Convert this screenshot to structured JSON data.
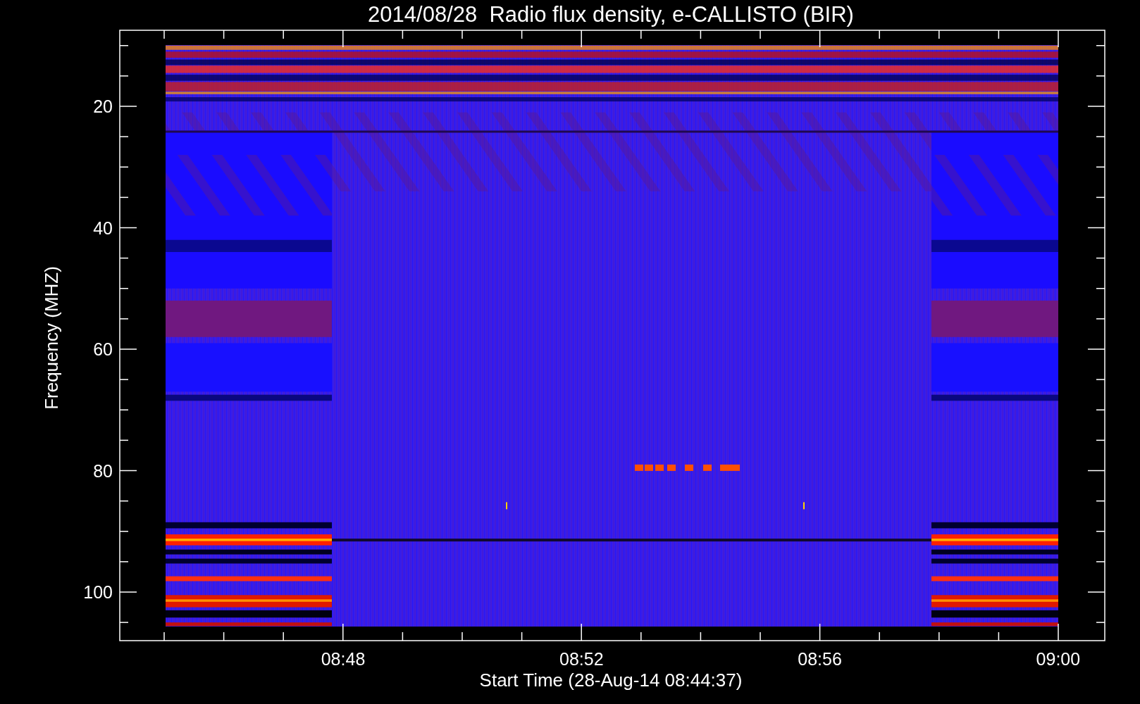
{
  "title": "2014/08/28  Radio flux density, e-CALLISTO (BIR)",
  "y_axis": {
    "label": "Frequency (MHZ)",
    "ticks": [
      "20",
      "40",
      "60",
      "80",
      "100"
    ]
  },
  "x_axis": {
    "label": "Start Time (28-Aug-14 08:44:37)",
    "ticks": [
      "08:48",
      "08:52",
      "08:56",
      "09:00"
    ]
  }
}
